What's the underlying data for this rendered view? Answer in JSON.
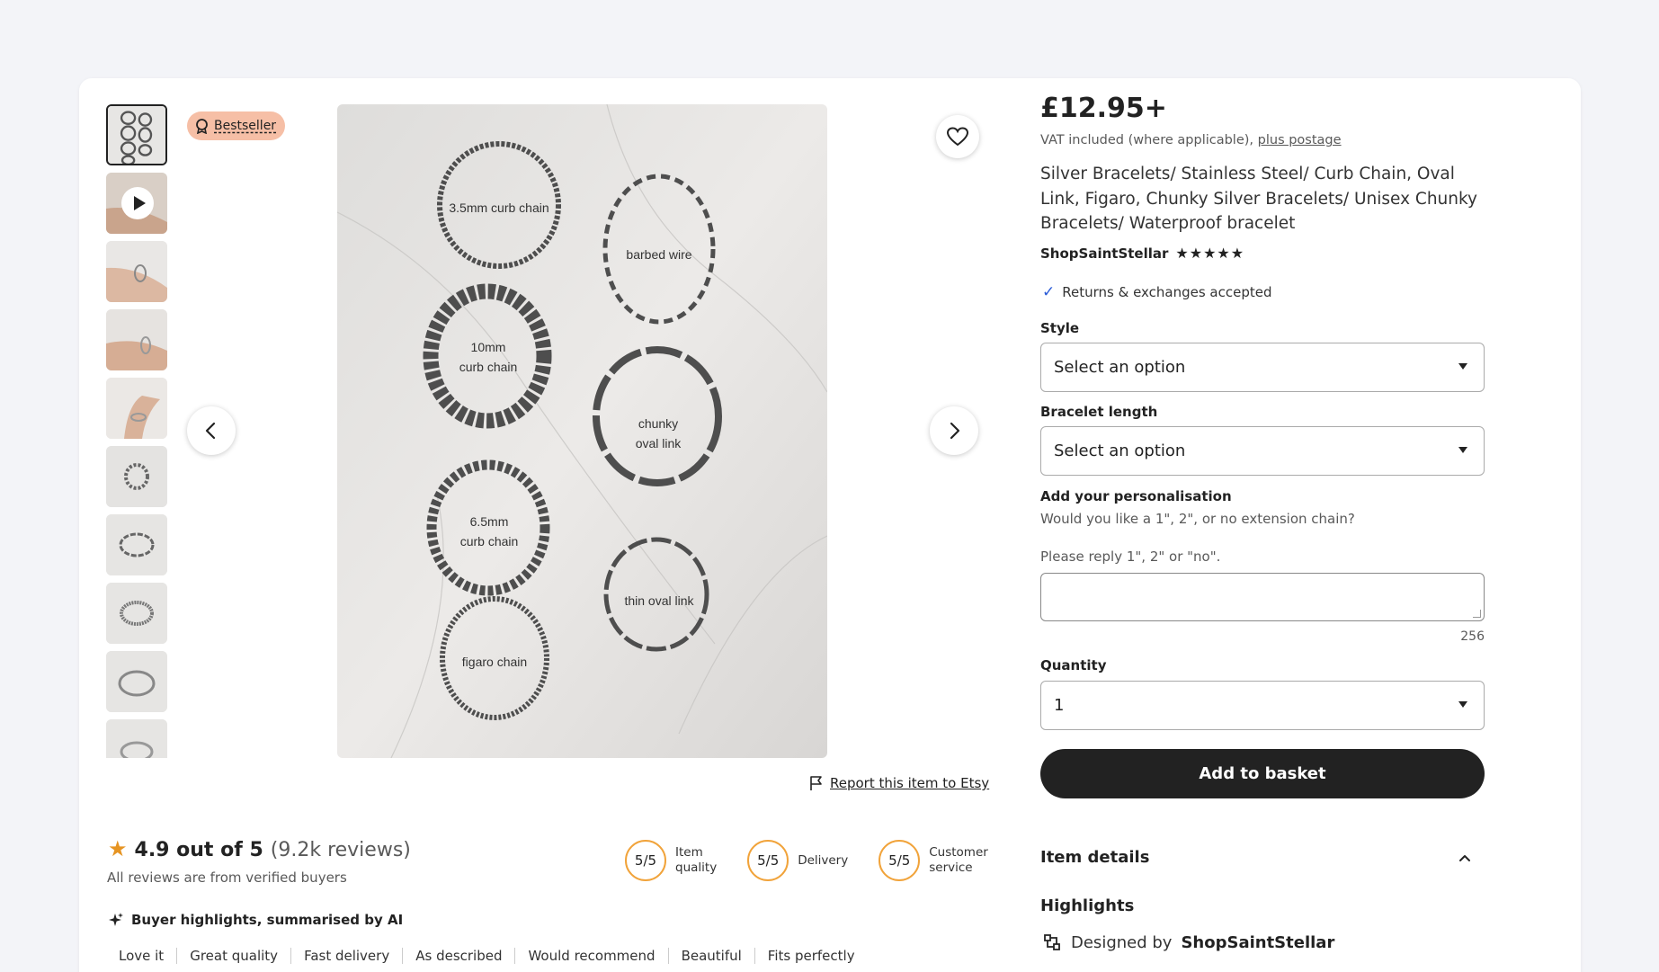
{
  "badge": {
    "label": "Bestseller"
  },
  "gallery": {
    "thumbnail_count": 10,
    "image_labels": [
      "3.5mm curb chain",
      "barbed wire",
      "10mm",
      "curb chain",
      "chunky",
      "oval link",
      "6.5mm",
      "curb chain",
      "thin oval link",
      "figaro chain"
    ]
  },
  "report_link": "Report this item to Etsy",
  "reviews": {
    "rating_text": "4.9 out of 5",
    "count_text": "(9.2k reviews)",
    "verified_note": "All reviews are from verified buyers",
    "scores": [
      {
        "value": "5/5",
        "label_line1": "Item",
        "label_line2": "quality"
      },
      {
        "value": "5/5",
        "label_line1": "Delivery",
        "label_line2": ""
      },
      {
        "value": "5/5",
        "label_line1": "Customer",
        "label_line2": "service"
      }
    ],
    "ai_title": "Buyer highlights, summarised by AI",
    "tags": [
      "Love it",
      "Great quality",
      "Fast delivery",
      "As described",
      "Would recommend",
      "Beautiful",
      "Fits perfectly"
    ]
  },
  "product": {
    "price": "£12.95+",
    "vat_text": "VAT included (where applicable),",
    "postage_link": "plus postage",
    "title": "Silver Bracelets/ Stainless Steel/ Curb Chain, Oval Link, Figaro, Chunky Silver Bracelets/ Unisex Chunky Bracelets/ Waterproof bracelet",
    "shop_name": "ShopSaintStellar",
    "shop_stars": "★★★★★",
    "returns_text": "Returns & exchanges accepted"
  },
  "options": {
    "style_label": "Style",
    "style_value": "Select an option",
    "length_label": "Bracelet length",
    "length_value": "Select an option"
  },
  "personalisation": {
    "label": "Add your personalisation",
    "question": "Would you like a 1\", 2\", or no extension chain?",
    "instruction": "Please reply 1\", 2\" or \"no\".",
    "char_count": "256"
  },
  "quantity": {
    "label": "Quantity",
    "value": "1"
  },
  "add_to_basket": "Add to basket",
  "item_details": {
    "heading": "Item details",
    "highlights_heading": "Highlights",
    "designed_prefix": "Designed by",
    "designed_shop": "ShopSaintStellar"
  },
  "colors": {
    "accent": "#f1a33a",
    "badge_bg": "#f6bfa6",
    "button_bg": "#222222",
    "check": "#2a5bd7"
  }
}
